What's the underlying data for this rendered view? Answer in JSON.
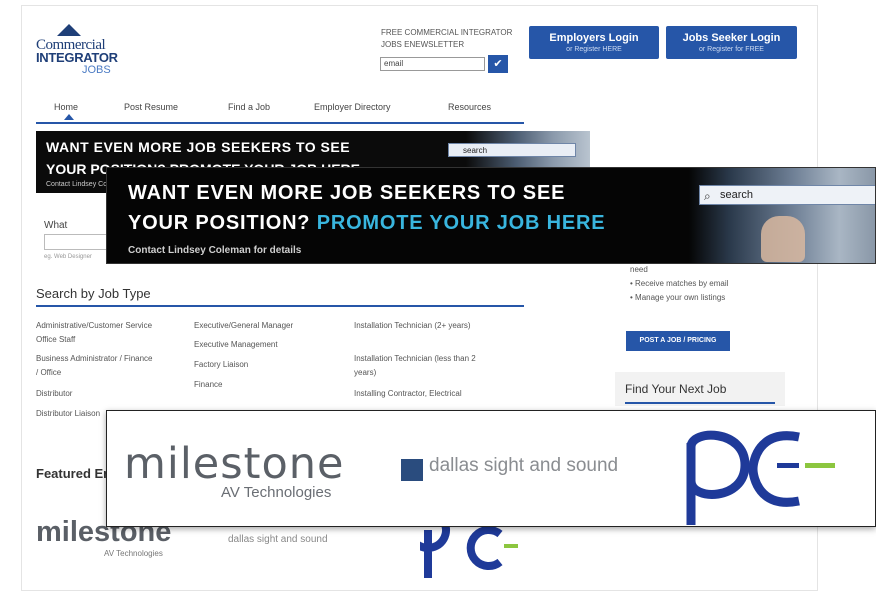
{
  "header": {
    "logo": {
      "line1": "Commercial",
      "line2": "INTEGRATOR",
      "line3": "JOBS"
    },
    "newsletter": {
      "label": "FREE COMMERCIAL INTEGRATOR JOBS ENEWSLETTER",
      "input_value": "email",
      "submit_icon": "checkmark-icon"
    },
    "employers_login": {
      "title": "Employers Login",
      "subtitle": "or Register HERE"
    },
    "jobseeker_login": {
      "title": "Jobs Seeker Login",
      "subtitle": "or Register for FREE"
    }
  },
  "nav": {
    "items": [
      "Home",
      "Post Resume",
      "Find a Job",
      "Employer Directory",
      "Resources"
    ],
    "active": "Home"
  },
  "banner_small": {
    "line1": "WANT EVEN MORE JOB SEEKERS TO SEE",
    "line2": "YOUR POSITION? PROMOTE YOUR JOB HERE",
    "contact": "Contact Lindsey Coleman for details",
    "search": "search"
  },
  "search_form": {
    "what_label": "What",
    "hint": "eg. Web Designer"
  },
  "job_types": {
    "heading": "Search by Job Type",
    "col1": [
      "Administrative/Customer Service Office Staff",
      "Business Administrator / Finance / Office",
      "Distributor",
      "Distributor Liaison"
    ],
    "col2": [
      "Executive/General Manager",
      "Executive Management",
      "Factory Liaison",
      "Finance"
    ],
    "col3": [
      "Installation Technician (2+ years)",
      "Installation Technician (less than 2 years)",
      "Installing Contractor, Electrical"
    ]
  },
  "right_panel": {
    "bullets": [
      "need",
      "Receive matches by email",
      "Manage your own listings"
    ],
    "post_button": "POST A JOB / PRICING",
    "find_next_job": "Find Your Next Job"
  },
  "featured": {
    "heading": "Featured Employers"
  },
  "banner": {
    "line1": "WANT EVEN MORE JOB SEEKERS TO SEE",
    "line2_a": "YOUR POSITION? ",
    "line2_b": "PROMOTE YOUR JOB HERE",
    "contact": "Contact Lindsey Coleman for details",
    "search": "search",
    "search_icon": "magnifier-icon"
  },
  "logos": {
    "milestone": "milestone",
    "milestone_sub": "AV Technologies",
    "dallas": "dallas sight and sound",
    "pc": "pc"
  },
  "colors": {
    "brand_blue": "#2656a8",
    "promo_cyan": "#39b6df",
    "pc_blue": "#1f3a99",
    "pc_green": "#8cc63f"
  }
}
